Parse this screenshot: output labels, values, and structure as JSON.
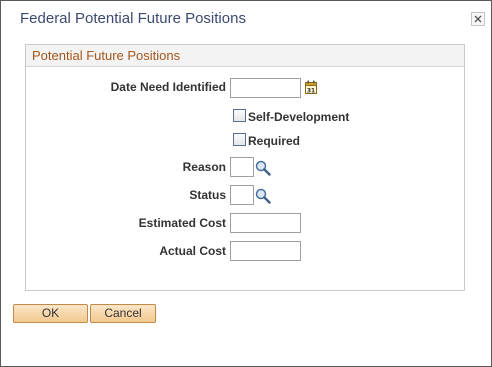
{
  "dialog": {
    "title": "Federal Potential Future Positions",
    "close_icon": "close-icon"
  },
  "section": {
    "title": "Potential Future Positions"
  },
  "fields": {
    "date_need_identified": {
      "label": "Date Need Identified",
      "value": "",
      "calendar_icon": "calendar-icon"
    },
    "self_development": {
      "label": "Self-Development",
      "checked": false
    },
    "required": {
      "label": "Required",
      "checked": false
    },
    "reason": {
      "label": "Reason",
      "value": "",
      "lookup_icon": "search-icon"
    },
    "status": {
      "label": "Status",
      "value": "",
      "lookup_icon": "search-icon"
    },
    "estimated_cost": {
      "label": "Estimated Cost",
      "value": ""
    },
    "actual_cost": {
      "label": "Actual Cost",
      "value": ""
    }
  },
  "buttons": {
    "ok": "OK",
    "cancel": "Cancel"
  },
  "colors": {
    "title_text": "#3b4a6e",
    "section_title": "#a5561c",
    "button_fill": "#f3c98f"
  }
}
